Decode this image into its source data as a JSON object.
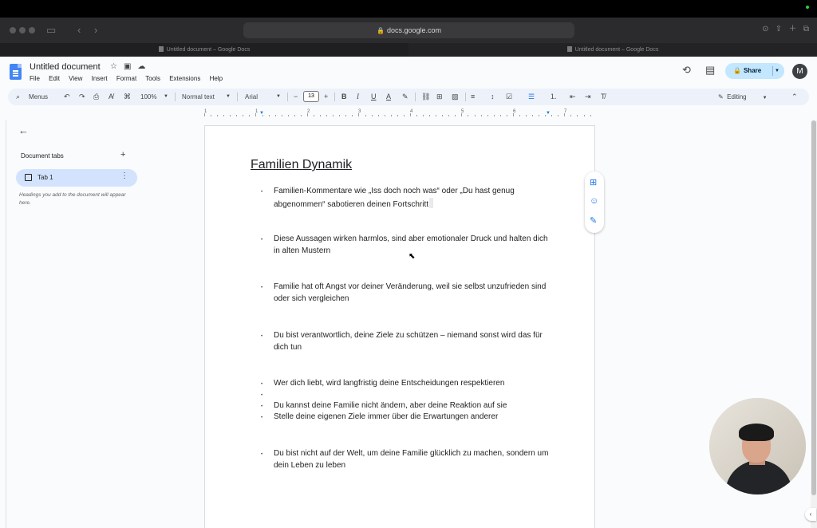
{
  "browser": {
    "url": "docs.google.com",
    "tabs": [
      {
        "label": "Untitled document – Google Docs",
        "active": true
      },
      {
        "label": "Untitled document – Google Docs",
        "active": false
      }
    ]
  },
  "header": {
    "doc_title": "Untitled document",
    "menu": [
      "File",
      "Edit",
      "View",
      "Insert",
      "Format",
      "Tools",
      "Extensions",
      "Help"
    ],
    "share_label": "Share",
    "avatar_initial": "M"
  },
  "toolbar": {
    "menus_label": "Menus",
    "zoom": "100%",
    "style": "Normal text",
    "font": "Arial",
    "font_size": "13",
    "mode": "Editing"
  },
  "ruler": {
    "numbers": [
      "1",
      "1",
      "2",
      "3",
      "4",
      "5",
      "6",
      "7"
    ]
  },
  "sidebar": {
    "title": "Document tabs",
    "tab_label": "Tab 1",
    "hint": "Headings you add to the document will appear here."
  },
  "document": {
    "heading": "Familien Dynamik",
    "bullets": [
      "Familien-Kommentare wie „Iss doch noch was“ oder „Du hast genug abgenommen“ sabotieren deinen Fortschritt",
      "Diese Aussagen wirken harmlos, sind aber emotionaler Druck und halten dich in alten Mustern",
      "Familie hat oft Angst vor deiner Veränderung, weil sie selbst unzufrieden sind oder sich vergleichen",
      "Du bist verantwortlich, deine Ziele zu schützen – niemand sonst wird das für dich tun",
      "Wer dich liebt, wird langfristig deine Entscheidungen respektieren",
      "",
      "Du kannst deine Familie nicht ändern, aber deine Reaktion auf sie",
      "Stelle deine eigenen Ziele immer über die Erwartungen anderer",
      "Du bist nicht auf der Welt, um deine Familie glücklich zu machen, sondern um dein Leben zu leben"
    ]
  },
  "colors": {
    "accent": "#1a73e8",
    "share_bg": "#c2e7ff",
    "selected_tab_bg": "#d3e3fd",
    "toolbar_bg": "#edf2fa"
  }
}
